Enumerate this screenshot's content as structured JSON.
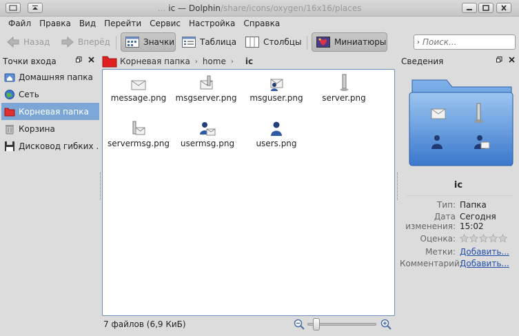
{
  "window": {
    "title_main": "ic — Dolphin",
    "title_path": "/share/icons/oxygen/16x16/places",
    "title_prefix": "…"
  },
  "menu": [
    "Файл",
    "Правка",
    "Вид",
    "Перейти",
    "Сервис",
    "Настройка",
    "Справка"
  ],
  "toolbar": {
    "back": "Назад",
    "forward": "Вперёд",
    "icons": "Значки",
    "details": "Таблица",
    "columns": "Столбцы",
    "preview": "Миниатюры",
    "search_placeholder": "Поиск..."
  },
  "places": {
    "title": "Точки входа",
    "items": [
      {
        "label": "Домашняя папка",
        "icon": "home-folder-icon"
      },
      {
        "label": "Сеть",
        "icon": "network-icon"
      },
      {
        "label": "Корневая папка",
        "icon": "root-folder-icon",
        "selected": true
      },
      {
        "label": "Корзина",
        "icon": "trash-icon"
      },
      {
        "label": "Дисковод гибких …",
        "icon": "floppy-icon"
      }
    ]
  },
  "breadcrumb": {
    "root": "Корневая папка",
    "home": "home",
    "current": "ic"
  },
  "files": [
    {
      "name": "message.png",
      "icon": "message-icon"
    },
    {
      "name": "msgserver.png",
      "icon": "msgserver-icon"
    },
    {
      "name": "msguser.png",
      "icon": "msguser-icon"
    },
    {
      "name": "server.png",
      "icon": "server-icon"
    },
    {
      "name": "servermsg.png",
      "icon": "servermsg-icon"
    },
    {
      "name": "usermsg.png",
      "icon": "usermsg-icon"
    },
    {
      "name": "users.png",
      "icon": "users-icon"
    }
  ],
  "status": {
    "summary": "7 файлов (6,9 КиБ)"
  },
  "info": {
    "title": "Сведения",
    "name": "ic",
    "type_label": "Тип:",
    "type_value": "Папка",
    "date_label": "Дата изменения:",
    "date_value_1": "Сегодня",
    "date_value_2": "15:02",
    "rating_label": "Оценка:",
    "rating": 0,
    "tags_label": "Метки:",
    "tags_value": "Добавить...",
    "comment_label": "Комментарий:",
    "comment_value": "Добавить..."
  }
}
